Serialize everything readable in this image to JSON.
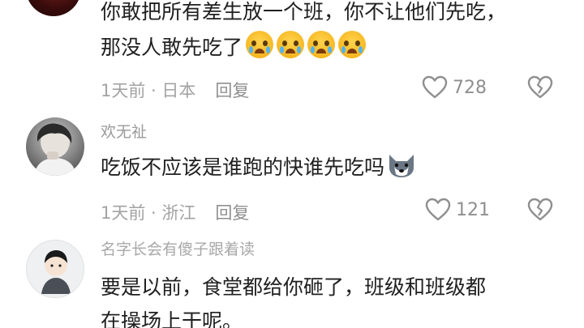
{
  "comments": [
    {
      "name": "",
      "lines": [
        "你敢把所有差生放一个班，你不让他们先吃，",
        "那没人敢先吃了"
      ],
      "emojis": [
        "crying-face-emoji",
        "crying-face-emoji",
        "crying-face-emoji",
        "crying-face-emoji"
      ],
      "meta": "1天前 · 日本",
      "reply_label": "回复",
      "likes": "728"
    },
    {
      "name": "欢无祉",
      "lines": [
        "吃饭不应该是谁跑的快谁先吃吗"
      ],
      "emojis": [
        "wolf-emoji"
      ],
      "meta": "1天前 · 浙江",
      "reply_label": "回复",
      "likes": "121"
    },
    {
      "name": "名字长会有傻子跟着读",
      "lines": [
        "要是以前，食堂都给你砸了，班级和班级都",
        "在操场上干呢。"
      ],
      "emojis": [],
      "meta": "",
      "reply_label": "",
      "likes": ""
    }
  ],
  "colors": {
    "text": "#202020",
    "muted": "#a3a3a3",
    "icon": "#8f8f8f"
  }
}
